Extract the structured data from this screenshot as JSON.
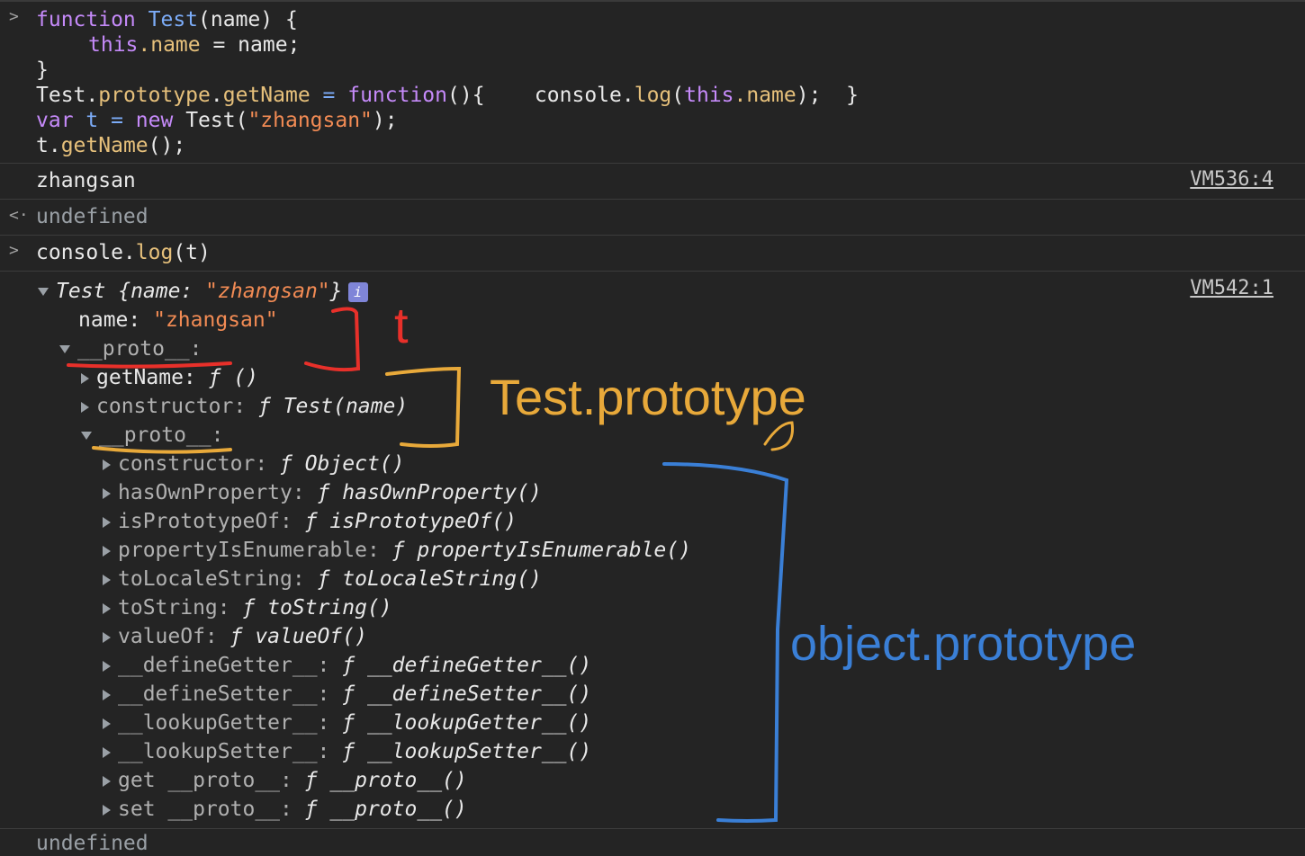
{
  "code_block": {
    "line1": {
      "kw": "function",
      "name": "Test",
      "params": "(name) {"
    },
    "line2": {
      "this": "this",
      "prop": ".name",
      "rest": " = name;"
    },
    "line3": "}",
    "line4": {
      "obj": "Test.",
      "proto": "prototype",
      "dot": ".",
      "method": "getName",
      "eq": " = ",
      "fn": "function",
      "rest": "(){    console.",
      "log": "log",
      "open": "(",
      "this": "this",
      "prop": ".name",
      "close": ");  }"
    },
    "line5": {
      "var": "var",
      "t": " t",
      "eq": " = ",
      "new": "new",
      "rest": " Test(",
      "str": "\"zhangsan\"",
      "close": ");"
    },
    "line6": {
      "t": "t.",
      "method": "getName",
      "rest": "();"
    }
  },
  "output1": {
    "text": "zhangsan",
    "link": "VM536:4"
  },
  "return1": {
    "text": "undefined"
  },
  "input2": {
    "obj": "console.",
    "method": "log",
    "args": "(t)"
  },
  "object_tree": {
    "link": "VM542:1",
    "root_label": "Test {name: ",
    "root_value": "\"zhangsan\"",
    "root_close": "}",
    "info_icon": "i",
    "name_key": "name: ",
    "name_value": "\"zhangsan\"",
    "proto1_key": "__proto__:",
    "getName_key": "getName: ",
    "getName_value": "ƒ ()",
    "constructor_key": "constructor: ",
    "constructor_value": "ƒ Test(name)",
    "proto2_key": "__proto__:",
    "object_members": [
      {
        "key": "constructor: ",
        "value": "ƒ Object()"
      },
      {
        "key": "hasOwnProperty: ",
        "value": "ƒ hasOwnProperty()"
      },
      {
        "key": "isPrototypeOf: ",
        "value": "ƒ isPrototypeOf()"
      },
      {
        "key": "propertyIsEnumerable: ",
        "value": "ƒ propertyIsEnumerable()"
      },
      {
        "key": "toLocaleString: ",
        "value": "ƒ toLocaleString()"
      },
      {
        "key": "toString: ",
        "value": "ƒ toString()"
      },
      {
        "key": "valueOf: ",
        "value": "ƒ valueOf()"
      },
      {
        "key": "__defineGetter__: ",
        "value": "ƒ __defineGetter__()"
      },
      {
        "key": "__defineSetter__: ",
        "value": "ƒ __defineSetter__()"
      },
      {
        "key": "__lookupGetter__: ",
        "value": "ƒ __lookupGetter__()"
      },
      {
        "key": "__lookupSetter__: ",
        "value": "ƒ __lookupSetter__()"
      },
      {
        "key": "get __proto__: ",
        "value": "ƒ __proto__()"
      },
      {
        "key": "set __proto__: ",
        "value": "ƒ __proto__()"
      }
    ]
  },
  "bottom_partial": "undefined",
  "annotations": {
    "t_label": "t",
    "test_prototype_label": "Test.prototype",
    "object_prototype_label": "object.prototype",
    "red": "#e8302a",
    "orange": "#e8a93a",
    "blue": "#3a7fd6"
  }
}
